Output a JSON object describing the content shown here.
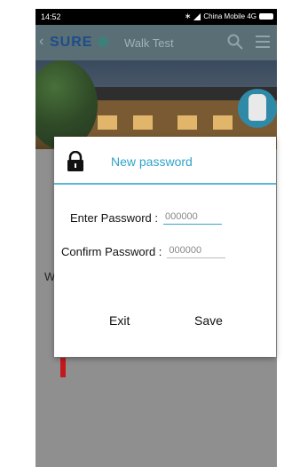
{
  "status_bar": {
    "time": "14:52",
    "carrier": "China Mobile 4G"
  },
  "app_bar": {
    "logo_text": "SURE",
    "title": "Walk Test"
  },
  "background": {
    "side_letter": "W"
  },
  "dialog": {
    "title": "New password",
    "enter_password_label": "Enter Password :",
    "enter_password_placeholder": "000000",
    "confirm_password_label": "Confirm Password :",
    "confirm_password_placeholder": "000000",
    "exit_label": "Exit",
    "save_label": "Save"
  },
  "colors": {
    "accent": "#2fa3c8",
    "divider": "#5bb6d6",
    "app_bar": "#5a6f75",
    "logo": "#1c4c8a"
  },
  "icons": {
    "lock": "lock-icon",
    "search": "search-icon",
    "menu": "menu-icon"
  }
}
